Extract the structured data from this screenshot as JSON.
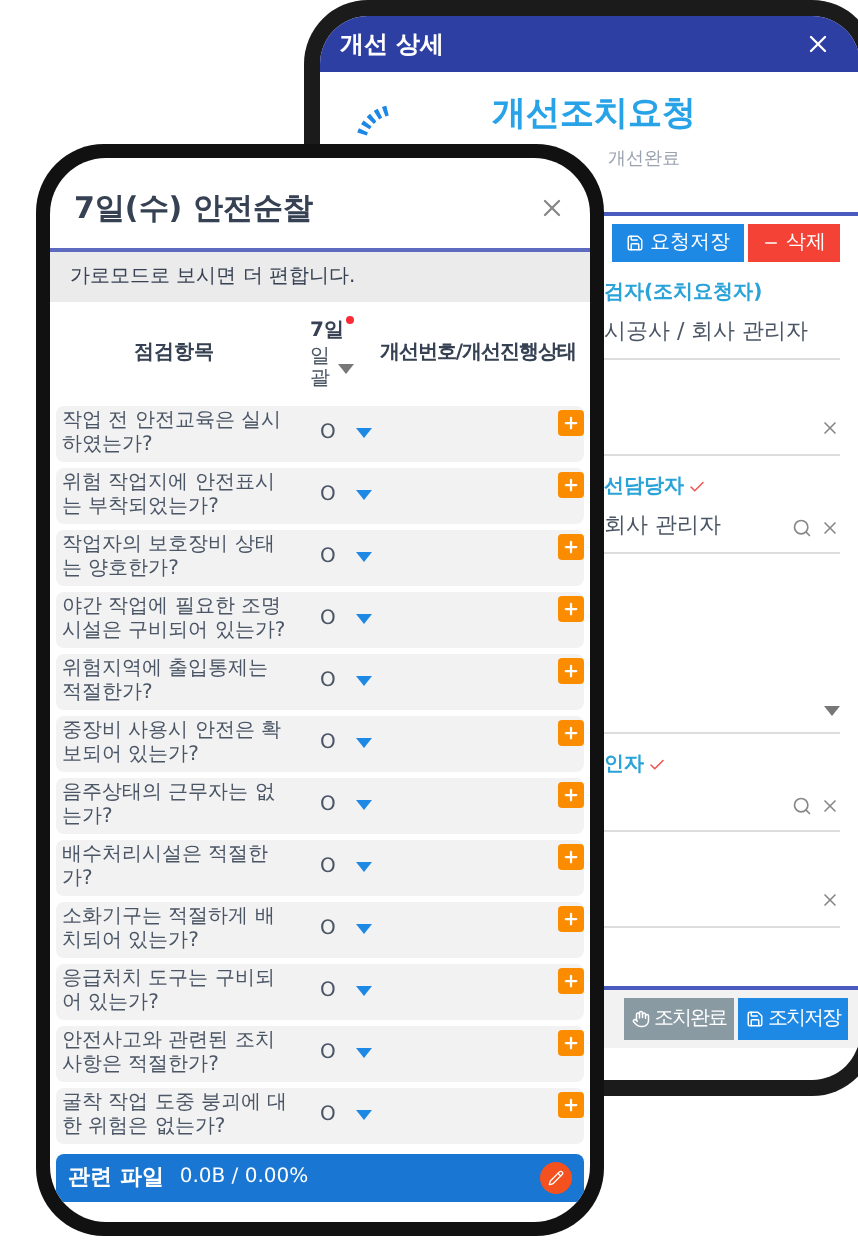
{
  "back_window": {
    "title": "개선 상세",
    "heading": "개선조치요청",
    "subheading": "개선완료",
    "toolbar_buttons": [
      {
        "label": "요청저장",
        "kind": "save"
      },
      {
        "label": "삭제",
        "kind": "delete"
      }
    ],
    "fields": [
      {
        "kind": "text",
        "label": "검자(조치요청자)",
        "required": false,
        "value": "시공사 / 회사 관리자"
      },
      {
        "kind": "clear"
      },
      {
        "kind": "lookup",
        "label": "선담당자",
        "required": true,
        "value": "회사 관리자"
      },
      {
        "kind": "select"
      },
      {
        "kind": "lookup",
        "label": "인자",
        "required": true
      },
      {
        "kind": "clear"
      }
    ],
    "footer_buttons": [
      {
        "label": "조치완료",
        "kind": "complete"
      },
      {
        "label": "조치저장",
        "kind": "save"
      }
    ]
  },
  "front_window": {
    "title": "7일(수) 안전순찰",
    "notice": "가로모드로 보시면 더 편합니다.",
    "columns": {
      "item": "점검항목",
      "day": "7일",
      "day_required": true,
      "bulk": "일괄",
      "status": "개선번호/개선진행상태"
    },
    "rows": [
      {
        "question": "작업 전 안전교육은 실시하였는가?",
        "answer": "O"
      },
      {
        "question": "위험 작업지에 안전표시는 부착되었는가?",
        "answer": "O"
      },
      {
        "question": "작업자의 보호장비 상태는 양호한가?",
        "answer": "O"
      },
      {
        "question": "야간 작업에 필요한 조명시설은 구비되어 있는가?",
        "answer": "O"
      },
      {
        "question": "위험지역에 출입통제는 적절한가?",
        "answer": "O"
      },
      {
        "question": "중장비 사용시 안전은 확보되어 있는가?",
        "answer": "O"
      },
      {
        "question": "음주상태의 근무자는 없는가?",
        "answer": "O"
      },
      {
        "question": "배수처리시설은 적절한가?",
        "answer": "O"
      },
      {
        "question": "소화기구는 적절하게 배치되어 있는가?",
        "answer": "O"
      },
      {
        "question": "응급처치 도구는 구비되어 있는가?",
        "answer": "O"
      },
      {
        "question": "안전사고와 관련된 조치사항은 적절한가?",
        "answer": "O"
      },
      {
        "question": "굴착 작업 도중 붕괴에 대한 위험은 없는가?",
        "answer": "O"
      }
    ],
    "footer": {
      "label": "관련 파일",
      "usage": "0.0B / 0.00%"
    }
  }
}
